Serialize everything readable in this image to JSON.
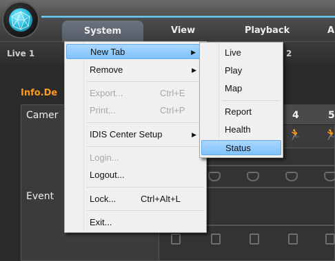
{
  "menubar": {
    "items": [
      {
        "label": "System"
      },
      {
        "label": "View"
      },
      {
        "label": "Playback"
      },
      {
        "label": "A"
      }
    ]
  },
  "tabs": {
    "live1": "Live 1",
    "partial": "2"
  },
  "panel": {
    "title": "Info.De",
    "rows": [
      "Camer",
      "Event"
    ],
    "columns": [
      "4",
      "5"
    ]
  },
  "system_menu": {
    "items": [
      {
        "label": "New Tab",
        "shortcut": "",
        "has_submenu": true,
        "disabled": false,
        "highlighted": true
      },
      {
        "label": "Remove",
        "shortcut": "",
        "has_submenu": true,
        "disabled": false
      },
      {
        "label": "Export...",
        "shortcut": "Ctrl+E",
        "disabled": true
      },
      {
        "label": "Print...",
        "shortcut": "Ctrl+P",
        "disabled": true
      },
      {
        "label": "IDIS Center Setup",
        "shortcut": "",
        "has_submenu": true,
        "disabled": false
      },
      {
        "label": "Login...",
        "shortcut": "",
        "disabled": true
      },
      {
        "label": "Logout...",
        "shortcut": "",
        "disabled": false
      },
      {
        "label": "Lock...",
        "shortcut": "Ctrl+Alt+L",
        "disabled": false
      },
      {
        "label": "Exit...",
        "shortcut": "",
        "disabled": false
      }
    ]
  },
  "new_tab_submenu": {
    "items": [
      {
        "label": "Live"
      },
      {
        "label": "Play"
      },
      {
        "label": "Map"
      },
      {
        "label": "Report"
      },
      {
        "label": "Health"
      },
      {
        "label": "Status",
        "highlighted": true
      }
    ]
  },
  "colors": {
    "accent_blue": "#7fc2fb",
    "title_orange": "#ff9a1c"
  }
}
